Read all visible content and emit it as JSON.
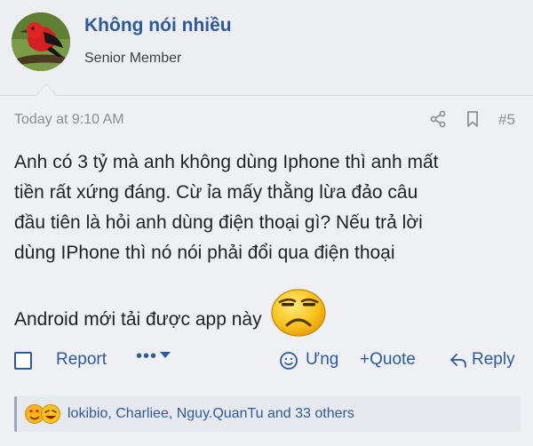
{
  "user": {
    "name": "Không nói nhiều",
    "title": "Senior Member"
  },
  "post": {
    "timestamp": "Today at 9:10 AM",
    "number": "#5",
    "message_lines": [
      "Anh có 3 tỷ mà anh không dùng Iphone thì anh mất",
      "tiền rất xứng đáng. Cừ ỉa mấy thằng lừa đảo câu",
      "đầu tiên là hỏi anh dùng điện thoại gì? Nếu trả lời",
      "dùng IPhone thì nó nói phải đổi qua điện thoại",
      "Android mới tải được app này"
    ],
    "inline_emoji": "unhappy-smiley"
  },
  "actions": {
    "report_label": "Report",
    "more_label": "•••",
    "react_label": "Ưng",
    "quote_label": "+Quote",
    "reply_label": "Reply"
  },
  "reactions": {
    "summary": "lokibio, Charliee, Nguy.QuanTu and 33 others",
    "icons": [
      "love-reaction-icon",
      "haha-reaction-icon"
    ]
  },
  "colors": {
    "accent": "#2f5a9a",
    "background": "#eef0f3",
    "muted_text": "#8a8d92"
  }
}
